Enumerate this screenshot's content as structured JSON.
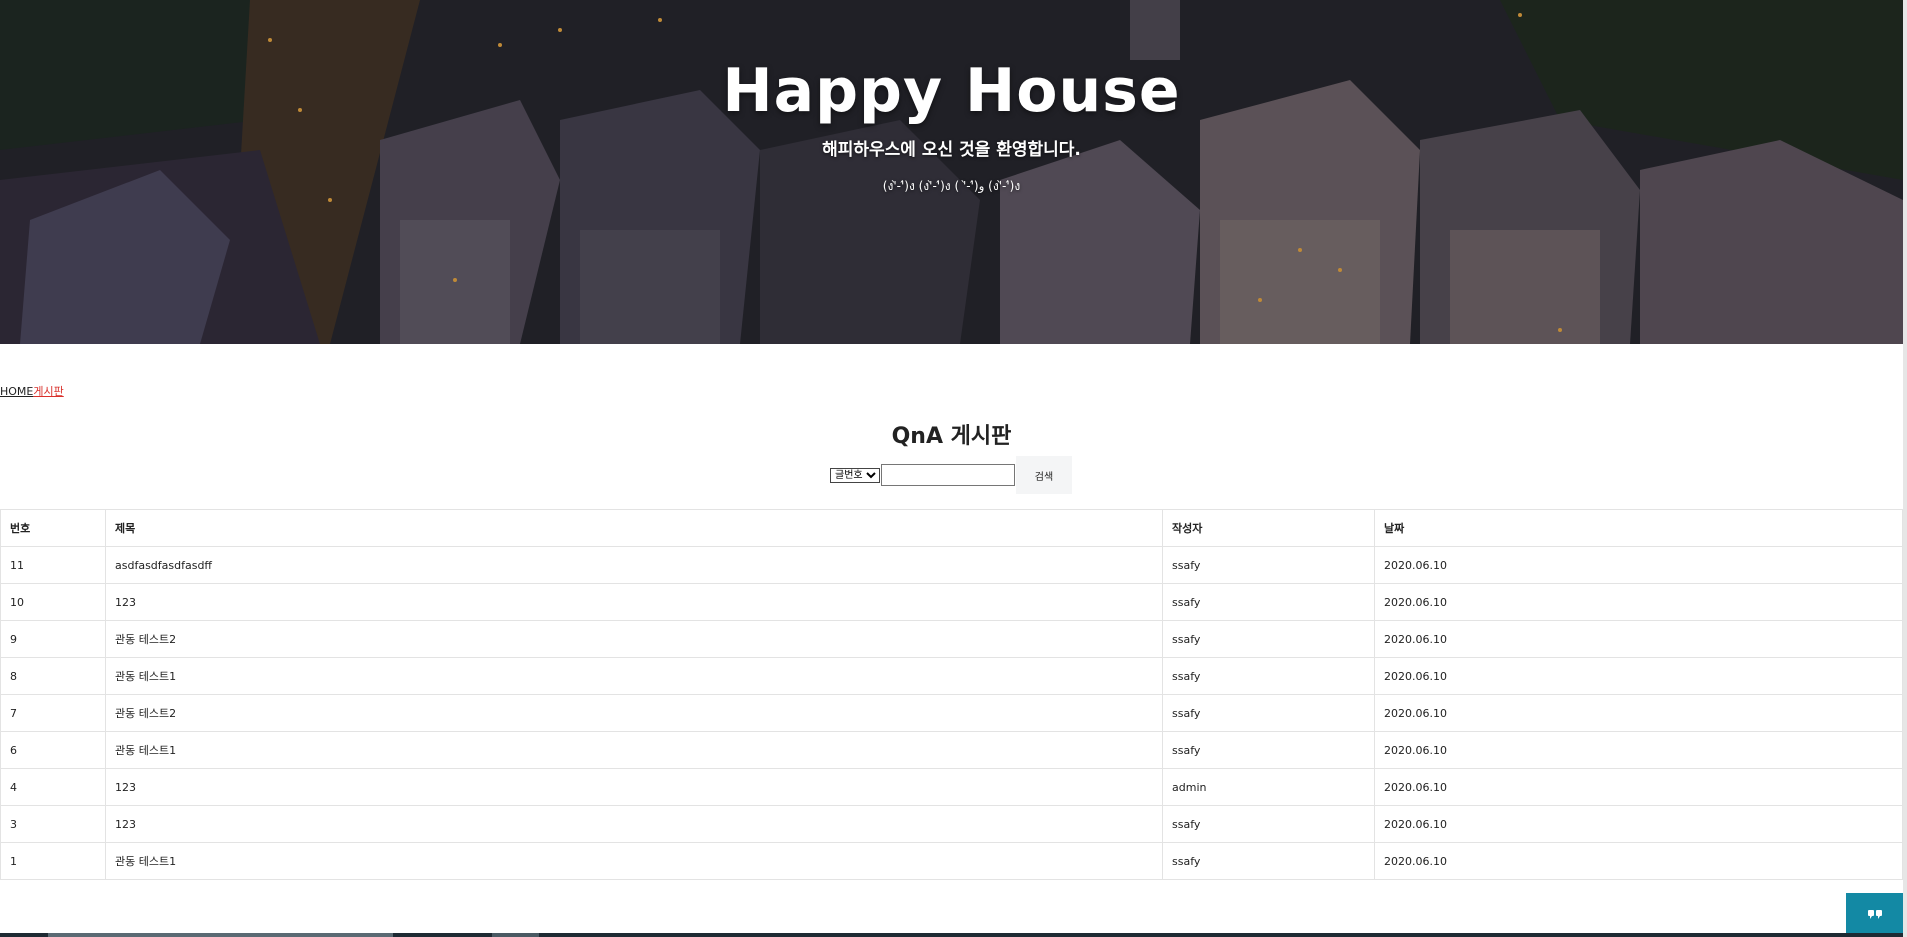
{
  "hero": {
    "title": "Happy House",
    "subtitle": "해피하우스에 오신 것을 환영합니다.",
    "emoji_line": "(ง'̀-'́)ง (ง'̀-'́)ง ( '̀-'́)و (ง'̀-'́)ง"
  },
  "breadcrumb": {
    "home": "HOME",
    "current": "게시판"
  },
  "board": {
    "title": "QnA 게시판",
    "search": {
      "select_value": "글번호",
      "input_value": "",
      "button_label": "검색"
    },
    "columns": [
      "번호",
      "제목",
      "작성자",
      "날짜"
    ],
    "rows": [
      {
        "no": "11",
        "title": "asdfasdfasdfasdff",
        "writer": "ssafy",
        "date": "2020.06.10"
      },
      {
        "no": "10",
        "title": "123",
        "writer": "ssafy",
        "date": "2020.06.10"
      },
      {
        "no": "9",
        "title": "관동 테스트2",
        "writer": "ssafy",
        "date": "2020.06.10"
      },
      {
        "no": "8",
        "title": "관동 테스트1",
        "writer": "ssafy",
        "date": "2020.06.10"
      },
      {
        "no": "7",
        "title": "관동 테스트2",
        "writer": "ssafy",
        "date": "2020.06.10"
      },
      {
        "no": "6",
        "title": "관동 테스트1",
        "writer": "ssafy",
        "date": "2020.06.10"
      },
      {
        "no": "4",
        "title": "123",
        "writer": "admin",
        "date": "2020.06.10"
      },
      {
        "no": "3",
        "title": "123",
        "writer": "ssafy",
        "date": "2020.06.10"
      },
      {
        "no": "1",
        "title": "관동 테스트1",
        "writer": "ssafy",
        "date": "2020.06.10"
      }
    ]
  },
  "chat_button": {
    "icon": "chat-icon"
  },
  "colors": {
    "accent": "#d9302b",
    "chat": "#1389a4"
  }
}
